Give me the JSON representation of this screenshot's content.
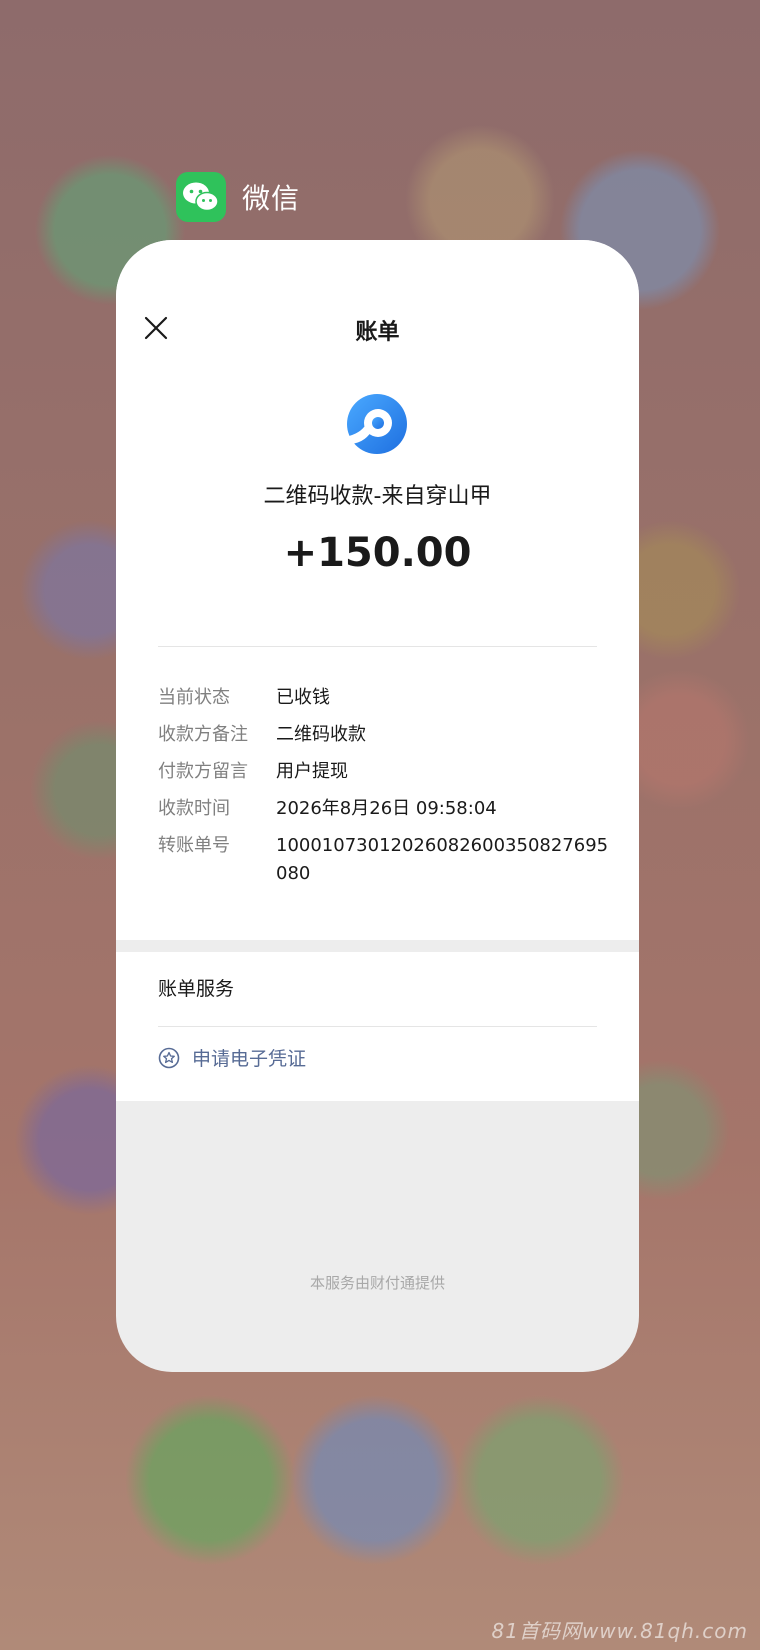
{
  "app": {
    "name": "微信",
    "icon": "wechat-icon"
  },
  "bill": {
    "title": "账单",
    "merchant_name": "二维码收款-来自穿山甲",
    "amount": "+150.00",
    "details": [
      {
        "label": "当前状态",
        "value": "已收钱"
      },
      {
        "label": "收款方备注",
        "value": "二维码收款"
      },
      {
        "label": "付款方留言",
        "value": "用户提现"
      },
      {
        "label": "收款时间",
        "value": "2026年8月26日 09:58:04"
      },
      {
        "label": "转账单号",
        "value": "10001073012026082600350827695080"
      }
    ]
  },
  "service": {
    "title": "账单服务",
    "link_label": "申请电子凭证",
    "link_icon": "star-circle-icon"
  },
  "footer": {
    "text": "本服务由财付通提供"
  },
  "watermark": {
    "text": "81首码网www.81qh.com"
  },
  "colors": {
    "wechat_green": "#2fc25b",
    "link_blue": "#576b95",
    "logo_blue": "#2f8cf0"
  }
}
